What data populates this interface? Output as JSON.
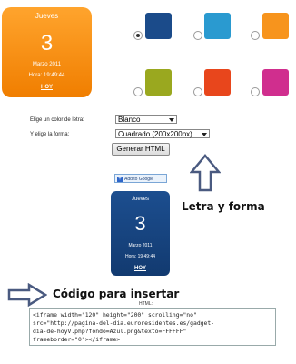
{
  "preview_large": {
    "weekday": "Jueves",
    "day": "3",
    "month_year": "Marzo 2011",
    "time": "Hora: 19:49:44",
    "today_link": "HOY",
    "color": "#f58c12"
  },
  "swatches": [
    {
      "color": "#1b4b8a",
      "selected": true
    },
    {
      "color": "#2a9ad0",
      "selected": false
    },
    {
      "color": "#f7941d",
      "selected": false
    },
    {
      "color": "#9aa81f",
      "selected": false
    },
    {
      "color": "#e8461c",
      "selected": false
    },
    {
      "color": "#d02e8e",
      "selected": false
    }
  ],
  "form": {
    "text_color_label": "Elige un color de letra:",
    "text_color_value": "Blanco",
    "shape_label": "Y elige la forma:",
    "shape_value": "Cuadrado (200x200px)",
    "generate_button": "Generar HTML"
  },
  "google_button": "Add to Google",
  "preview_small": {
    "weekday": "Jueves",
    "day": "3",
    "month_year": "Marzo 2011",
    "time": "Hora: 19:49:44",
    "today_link": "HOY",
    "color": "#1b4b8a"
  },
  "annotations": {
    "letra_forma": "Letra y forma",
    "codigo": "Código  para insertar"
  },
  "html_caption": "HTML:",
  "embed_code": "<iframe width=\"120\" height=\"200\" scrolling=\"no\"\nsrc=\"http://pagina-del-dia.euroresidentes.es/gadget-\ndia-de-hoyV.php?fondo=Azul.png&texto=FFFFFF\"\nframeborder=\"0\"></iframe>"
}
